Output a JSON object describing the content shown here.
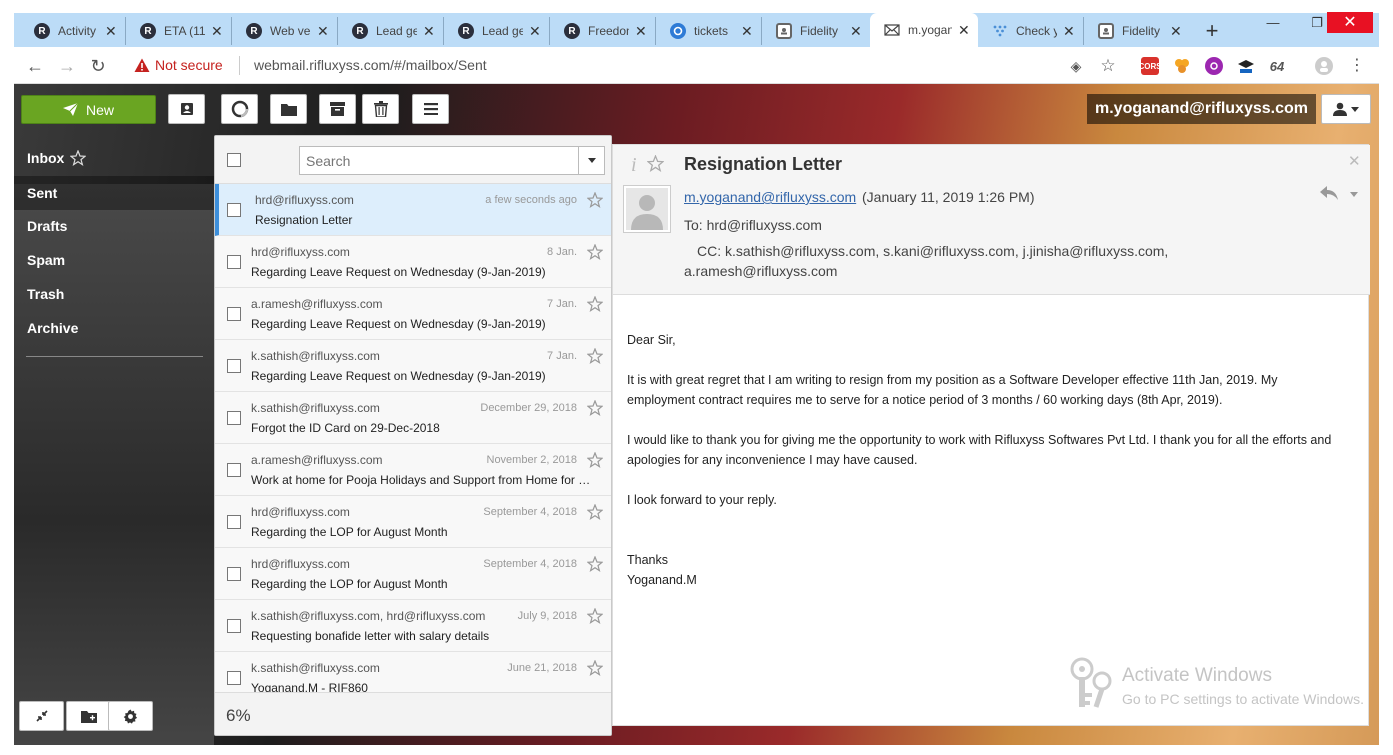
{
  "browser": {
    "tabs": [
      {
        "title": "Activity",
        "icon": "R"
      },
      {
        "title": "ETA (11",
        "icon": "R"
      },
      {
        "title": "Web ve",
        "icon": "R"
      },
      {
        "title": "Lead ge",
        "icon": "R"
      },
      {
        "title": "Lead ge",
        "icon": "R"
      },
      {
        "title": "Freedon",
        "icon": "R"
      },
      {
        "title": "tickets",
        "icon": "ticket"
      },
      {
        "title": "Fidelity",
        "icon": "fidelity"
      },
      {
        "title": "m.yogan",
        "icon": "mail"
      },
      {
        "title": "Check y",
        "icon": "dots"
      },
      {
        "title": "Fidelity",
        "icon": "fidelity"
      }
    ],
    "new_tab": "+",
    "not_secure": "Not secure",
    "url": "webmail.rifluxyss.com/#/mailbox/Sent",
    "extension_labels": [
      "CORS",
      "64"
    ]
  },
  "app": {
    "new_label": "New",
    "user_email": "m.yoganand@rifluxyss.com",
    "folders": [
      {
        "label": "Inbox",
        "starred": true
      },
      {
        "label": "Sent",
        "active": true
      },
      {
        "label": "Drafts"
      },
      {
        "label": "Spam"
      },
      {
        "label": "Trash"
      },
      {
        "label": "Archive"
      }
    ],
    "search_placeholder": "Search",
    "progress": "6%"
  },
  "messages": [
    {
      "from": "hrd@rifluxyss.com",
      "date": "a few seconds ago",
      "subject": "Resignation Letter",
      "selected": true
    },
    {
      "from": "hrd@rifluxyss.com",
      "date": "8 Jan.",
      "subject": "Regarding Leave Request on Wednesday (9-Jan-2019)"
    },
    {
      "from": "a.ramesh@rifluxyss.com",
      "date": "7 Jan.",
      "subject": "Regarding Leave Request on Wednesday (9-Jan-2019)"
    },
    {
      "from": "k.sathish@rifluxyss.com",
      "date": "7 Jan.",
      "subject": "Regarding Leave Request on Wednesday (9-Jan-2019)"
    },
    {
      "from": "k.sathish@rifluxyss.com",
      "date": "December 29, 2018",
      "subject": "Forgot the ID Card on 29-Dec-2018"
    },
    {
      "from": "a.ramesh@rifluxyss.com",
      "date": "November 2, 2018",
      "subject": "Work at home for Pooja Holidays and Support from Home for Diwali"
    },
    {
      "from": "hrd@rifluxyss.com",
      "date": "September 4, 2018",
      "subject": "Regarding the LOP for August Month"
    },
    {
      "from": "hrd@rifluxyss.com",
      "date": "September 4, 2018",
      "subject": "Regarding the LOP for August Month"
    },
    {
      "from": "k.sathish@rifluxyss.com, hrd@rifluxyss.com",
      "date": "July 9, 2018",
      "subject": "Requesting bonafide letter with salary details"
    },
    {
      "from": "k.sathish@rifluxyss.com",
      "date": "June 21, 2018",
      "subject": "Yoganand.M - RIF860"
    }
  ],
  "message_view": {
    "title": "Resignation Letter",
    "from": "m.yoganand@rifluxyss.com",
    "date": "(January 11, 2019 1:26 PM)",
    "to_label": "To:",
    "to": "hrd@rifluxyss.com",
    "cc_label": "CC:",
    "cc_line1": "k.sathish@rifluxyss.com, s.kani@rifluxyss.com, j.jinisha@rifluxyss.com,",
    "cc_line2": "a.ramesh@rifluxyss.com",
    "body": {
      "greeting": "Dear Sir,",
      "p1": "It is with great regret that I am writing to resign from my position as a Software Developer effective 11th Jan, 2019. My employment contract requires me to serve for a notice period of 3 months / 60 working days (8th Apr, 2019).",
      "p2": "I would like to thank you for giving me the opportunity to work with Rifluxyss Softwares Pvt Ltd. I thank you for all the efforts and apologies for any inconvenience I may have caused.",
      "p3": "I look forward to your reply.",
      "closing": "Thanks",
      "signature": "Yoganand.M"
    }
  },
  "watermark": {
    "line1": "Activate Windows",
    "line2": "Go to PC settings to activate Windows."
  }
}
